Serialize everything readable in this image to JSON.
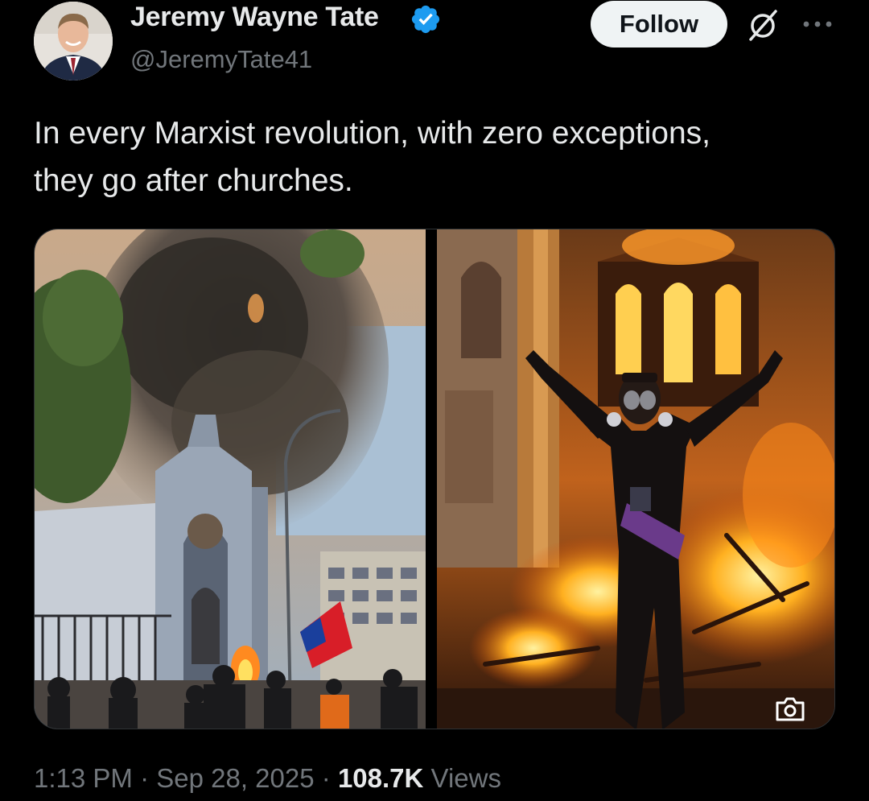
{
  "author": {
    "display_name": "Jeremy Wayne Tate",
    "handle": "@JeremyTate41",
    "verified": true,
    "verified_color": "#1d9bf0"
  },
  "actions": {
    "follow_label": "Follow",
    "grok_icon": "grok-icon",
    "more_icon": "more-horizontal-icon"
  },
  "tweet": {
    "text_line1": "In every Marxist revolution, with zero exceptions,",
    "text_line2": "they go after churches."
  },
  "media": {
    "left_image": "church-burning-smoke-photo",
    "right_image": "protester-fire-photo",
    "camera_icon": "camera-icon"
  },
  "meta": {
    "time": "1:13 PM",
    "separator": "·",
    "date": "Sep 28, 2025",
    "views_count": "108.7K",
    "views_label": "Views"
  },
  "colors": {
    "background": "#000000",
    "text_primary": "#e7e9ea",
    "text_secondary": "#71767b",
    "follow_bg": "#eff3f4",
    "follow_text": "#0f1419"
  }
}
